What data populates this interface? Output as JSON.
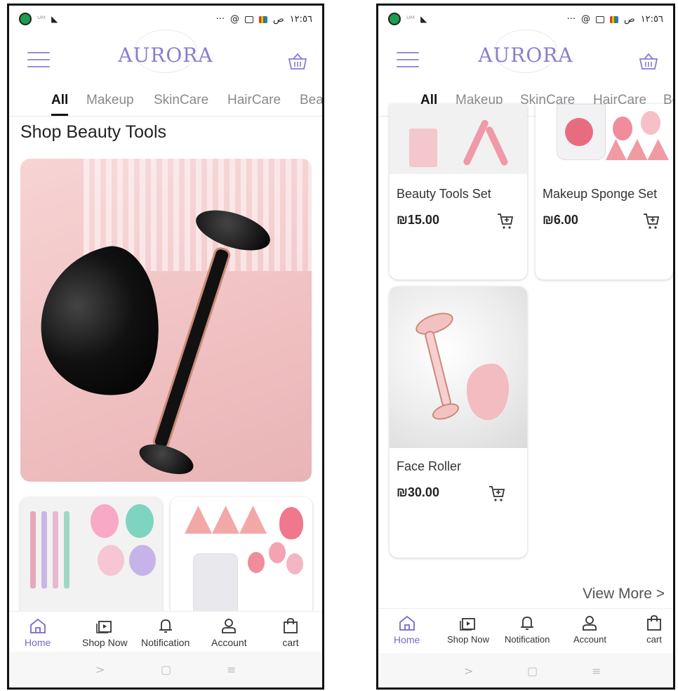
{
  "status_bar": {
    "time": "١٢:٥٦",
    "period": "ص",
    "dots": "···"
  },
  "header": {
    "logo": "AURORA"
  },
  "categories": [
    {
      "label": "All"
    },
    {
      "label": "Makeup"
    },
    {
      "label": "SkinCare"
    },
    {
      "label": "HairCare"
    },
    {
      "label": "Bea"
    }
  ],
  "section_title": "Shop Beauty Tools",
  "products": [
    {
      "name": "Beauty Tools Set",
      "price": "₪15.00"
    },
    {
      "name": "Makeup Sponge Set",
      "price": "₪6.00"
    },
    {
      "name": "Face Roller",
      "price": "₪30.00"
    }
  ],
  "view_more": "View More >",
  "bottom_nav": [
    {
      "label": "Home",
      "icon": "home-icon"
    },
    {
      "label": "Shop Now",
      "icon": "shop-now-icon"
    },
    {
      "label": "Notification",
      "icon": "bell-icon"
    },
    {
      "label": "Account",
      "icon": "account-icon"
    },
    {
      "label": "cart",
      "icon": "shopping-bag-icon"
    }
  ],
  "system_nav": {
    "back": ">",
    "home": "▢",
    "recents": "≡"
  },
  "colors": {
    "accent": "#8b7bd0",
    "hero_bg": "#f1c3c4",
    "text": "#222222"
  }
}
